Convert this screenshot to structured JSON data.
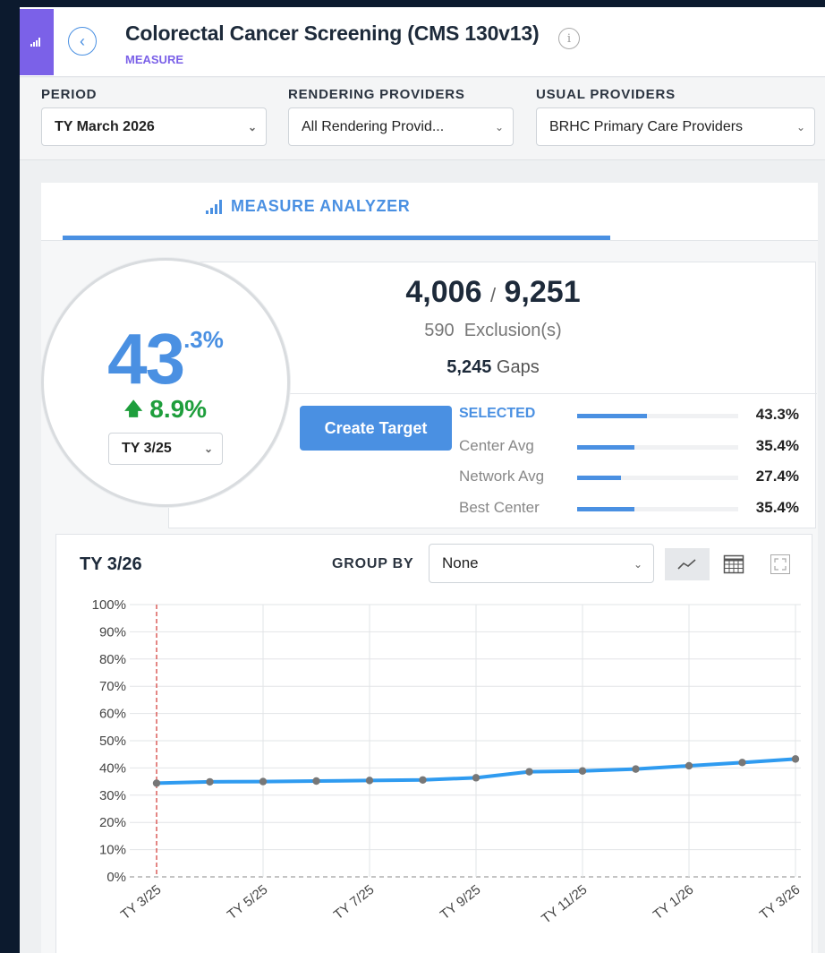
{
  "header": {
    "title": "Colorectal Cancer Screening (CMS 130v13)",
    "subtitle": "MEASURE"
  },
  "filters": {
    "period": {
      "label": "PERIOD",
      "value": "TY March 2026"
    },
    "rendering": {
      "label": "RENDERING PROVIDERS",
      "value": "All Rendering Provid..."
    },
    "usual": {
      "label": "USUAL PROVIDERS",
      "value": "BRHC Primary Care Providers"
    }
  },
  "analyzer": {
    "tab_label": "MEASURE ANALYZER",
    "score_int": "43",
    "score_dec": ".3%",
    "delta": "8.9%",
    "compare_period": "TY 3/25",
    "numerator": "4,006",
    "slash": "/",
    "denominator": "9,251",
    "exclusions_count": "590",
    "exclusions_label": "Exclusion(s)",
    "gaps_count": "5,245",
    "gaps_label": "Gaps",
    "create_target": "Create Target",
    "comparisons": [
      {
        "label": "SELECTED",
        "value": "43.3%",
        "pct": 43.3
      },
      {
        "label": "Center Avg",
        "value": "35.4%",
        "pct": 35.4
      },
      {
        "label": "Network Avg",
        "value": "27.4%",
        "pct": 27.4
      },
      {
        "label": "Best Center",
        "value": "35.4%",
        "pct": 35.4
      }
    ]
  },
  "trend": {
    "title": "TY 3/26",
    "group_by_label": "GROUP BY",
    "group_by_value": "None"
  },
  "colors": {
    "accent": "#4a90e2",
    "brand": "#7b61e8",
    "positive": "#1e9e3c",
    "reference_line": "#d9534f"
  },
  "chart_data": {
    "type": "line",
    "x": [
      "TY 3/25",
      "TY 4/25",
      "TY 5/25",
      "TY 6/25",
      "TY 7/25",
      "TY 8/25",
      "TY 9/25",
      "TY 10/25",
      "TY 11/25",
      "TY 12/25",
      "TY 1/26",
      "TY 2/26",
      "TY 3/26"
    ],
    "x_tick_labels": [
      "TY 3/25",
      "TY 5/25",
      "TY 7/25",
      "TY 9/25",
      "TY 11/25",
      "TY 1/26",
      "TY 3/26"
    ],
    "series": [
      {
        "values": [
          34.4,
          34.9,
          35.0,
          35.2,
          35.4,
          35.6,
          36.4,
          38.6,
          38.9,
          39.6,
          40.8,
          42.0,
          43.3
        ]
      }
    ],
    "y_ticks": [
      "0%",
      "10%",
      "20%",
      "30%",
      "40%",
      "50%",
      "60%",
      "70%",
      "80%",
      "90%",
      "100%"
    ],
    "ylim": [
      0,
      100
    ],
    "reference_x": "TY 3/25",
    "grid": true,
    "xlabel": "",
    "ylabel": "",
    "title": ""
  }
}
